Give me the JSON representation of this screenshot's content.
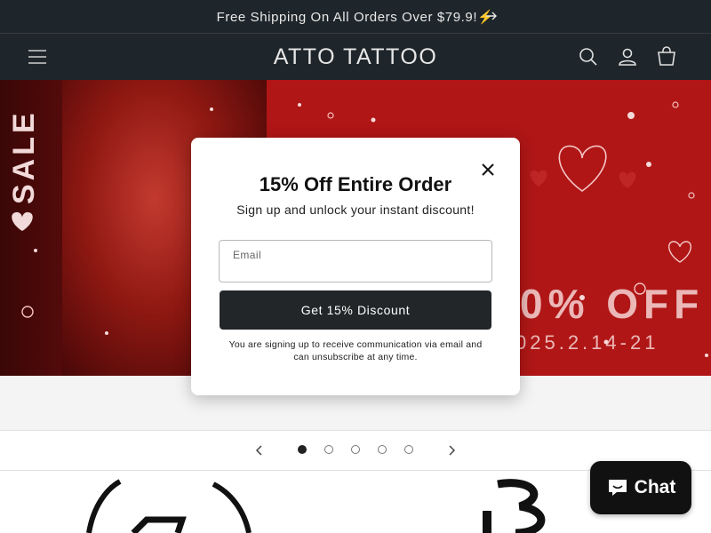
{
  "announcement": {
    "text": "Free Shipping On All Orders Over $79.9!⚡",
    "arrow_icon": "arrow-right-icon"
  },
  "header": {
    "logo": "ATTO TATTOO",
    "menu_icon": "hamburger-menu-icon",
    "search_icon": "search-icon",
    "account_icon": "user-icon",
    "cart_icon": "cart-icon"
  },
  "hero": {
    "sale_text": "SALE",
    "offer_text": "0% OFF",
    "date_text": "025.2.14-21",
    "colors": {
      "background": "#b01616",
      "text": "#f2c9c9"
    }
  },
  "slider": {
    "prev_icon": "chevron-left-icon",
    "next_icon": "chevron-right-icon",
    "slide_count": 5,
    "active_index": 0
  },
  "modal": {
    "title": "15% Off Entire Order",
    "subtitle": "Sign up and unlock your instant discount!",
    "email_label": "Email",
    "email_value": "",
    "cta_label": "Get 15% Discount",
    "fine_print": "You are signing up to receive communication via email and can unsubscribe at any time.",
    "close_icon": "close-icon"
  },
  "chat": {
    "label": "Chat",
    "icon": "chat-bubble-icon"
  },
  "theme": {
    "dark": "#1f262b",
    "button": "#232628"
  }
}
